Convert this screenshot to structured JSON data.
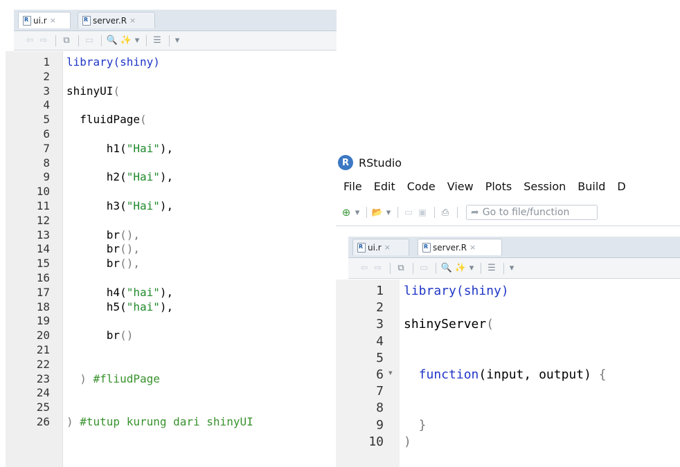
{
  "left_editor": {
    "tabs": [
      {
        "label": "ui.r",
        "close": "×"
      },
      {
        "label": "server.R",
        "close": "×"
      }
    ],
    "code": [
      {
        "n": "1",
        "parts": [
          {
            "t": "library",
            "c": "kw"
          },
          {
            "t": "(shiny)",
            "c": "kw"
          }
        ]
      },
      {
        "n": "2",
        "parts": []
      },
      {
        "n": "3",
        "parts": [
          {
            "t": "shinyUI",
            "c": ""
          },
          {
            "t": "(",
            "c": "pn"
          }
        ]
      },
      {
        "n": "4",
        "parts": []
      },
      {
        "n": "5",
        "parts": [
          {
            "t": "  fluidPage",
            "c": ""
          },
          {
            "t": "(",
            "c": "pn"
          }
        ]
      },
      {
        "n": "6",
        "parts": []
      },
      {
        "n": "7",
        "parts": [
          {
            "t": "      h1(",
            "c": ""
          },
          {
            "t": "\"Hai\"",
            "c": "str"
          },
          {
            "t": "),",
            "c": ""
          }
        ]
      },
      {
        "n": "8",
        "parts": []
      },
      {
        "n": "9",
        "parts": [
          {
            "t": "      h2(",
            "c": ""
          },
          {
            "t": "\"Hai\"",
            "c": "str"
          },
          {
            "t": "),",
            "c": ""
          }
        ]
      },
      {
        "n": "10",
        "parts": []
      },
      {
        "n": "11",
        "parts": [
          {
            "t": "      h3(",
            "c": ""
          },
          {
            "t": "\"Hai\"",
            "c": "str"
          },
          {
            "t": "),",
            "c": ""
          }
        ]
      },
      {
        "n": "12",
        "parts": []
      },
      {
        "n": "13",
        "parts": [
          {
            "t": "      br",
            "c": ""
          },
          {
            "t": "(),",
            "c": "pn"
          }
        ]
      },
      {
        "n": "14",
        "parts": [
          {
            "t": "      br",
            "c": ""
          },
          {
            "t": "(),",
            "c": "pn"
          }
        ]
      },
      {
        "n": "15",
        "parts": [
          {
            "t": "      br",
            "c": ""
          },
          {
            "t": "(),",
            "c": "pn"
          }
        ]
      },
      {
        "n": "16",
        "parts": []
      },
      {
        "n": "17",
        "parts": [
          {
            "t": "      h4(",
            "c": ""
          },
          {
            "t": "\"hai\"",
            "c": "str"
          },
          {
            "t": "),",
            "c": ""
          }
        ]
      },
      {
        "n": "18",
        "parts": [
          {
            "t": "      h5(",
            "c": ""
          },
          {
            "t": "\"hai\"",
            "c": "str"
          },
          {
            "t": "),",
            "c": ""
          }
        ]
      },
      {
        "n": "19",
        "parts": []
      },
      {
        "n": "20",
        "parts": [
          {
            "t": "      br",
            "c": ""
          },
          {
            "t": "()",
            "c": "pn"
          }
        ]
      },
      {
        "n": "21",
        "parts": []
      },
      {
        "n": "22",
        "parts": []
      },
      {
        "n": "23",
        "parts": [
          {
            "t": "  ) ",
            "c": "pn"
          },
          {
            "t": "#fliudPage",
            "c": "cmt"
          }
        ]
      },
      {
        "n": "24",
        "parts": []
      },
      {
        "n": "25",
        "parts": []
      },
      {
        "n": "26",
        "parts": [
          {
            "t": ") ",
            "c": "pn"
          },
          {
            "t": "#tutup kurung dari shinyUI",
            "c": "cmt"
          }
        ]
      }
    ]
  },
  "right_window": {
    "app_title": "RStudio",
    "logo_letter": "R",
    "menu": [
      "File",
      "Edit",
      "Code",
      "View",
      "Plots",
      "Session",
      "Build",
      "D"
    ],
    "goto_placeholder": "Go to file/function",
    "tabs": [
      {
        "label": "ui.r",
        "close": "×"
      },
      {
        "label": "server.R",
        "close": "×"
      }
    ],
    "code": [
      {
        "n": "1",
        "fold": "",
        "parts": [
          {
            "t": "library(shiny)",
            "c": "kw"
          }
        ]
      },
      {
        "n": "2",
        "fold": "",
        "parts": []
      },
      {
        "n": "3",
        "fold": "",
        "parts": [
          {
            "t": "shinyServer",
            "c": ""
          },
          {
            "t": "(",
            "c": "pn"
          }
        ]
      },
      {
        "n": "4",
        "fold": "",
        "parts": []
      },
      {
        "n": "5",
        "fold": "",
        "parts": []
      },
      {
        "n": "6",
        "fold": "▾",
        "parts": [
          {
            "t": "  function",
            "c": "kw"
          },
          {
            "t": "(input, output) ",
            "c": ""
          },
          {
            "t": "{",
            "c": "pn"
          }
        ]
      },
      {
        "n": "7",
        "fold": "",
        "parts": []
      },
      {
        "n": "8",
        "fold": "",
        "parts": []
      },
      {
        "n": "9",
        "fold": "",
        "parts": [
          {
            "t": "  }",
            "c": "pn"
          }
        ]
      },
      {
        "n": "10",
        "fold": "",
        "parts": [
          {
            "t": ")",
            "c": "pn"
          }
        ]
      }
    ]
  },
  "icons": {
    "back": "⇦",
    "forward": "⇨",
    "show-in-window": "⧉",
    "save": "▭",
    "search": "🔍",
    "wand": "✨",
    "dropdown": "▾",
    "outline": "☰",
    "new-file": "⊕",
    "open-folder": "📂",
    "save-all": "▣",
    "print": "⎙",
    "goto-arrow": "➦"
  }
}
